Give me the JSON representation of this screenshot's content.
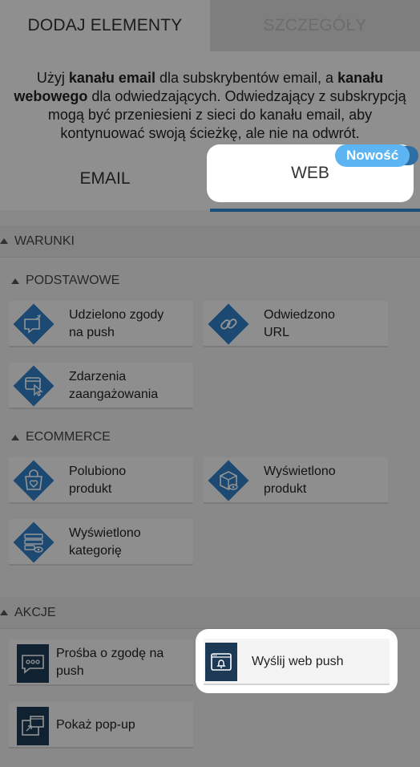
{
  "tabs": {
    "add_elements": "DODAJ ELEMENTY",
    "details": "SZCZEGÓŁY"
  },
  "description": {
    "part1": "Użyj ",
    "bold1": "kanału email",
    "part2": " dla subskrybentów email, a ",
    "bold2": "kanału webowego",
    "part3": " dla odwiedzających. Odwiedzający z subskrypcją mogą być przeniesieni z sieci do kanału email, aby kontynuować swoją ścieżkę, ale nie na odwrót."
  },
  "channels": {
    "email": "EMAIL",
    "web": "WEB",
    "new_badge": "Nowość"
  },
  "sections": {
    "conditions": "WARUNKI",
    "basic": "PODSTAWOWE",
    "ecommerce": "ECOMMERCE",
    "actions": "AKCJE"
  },
  "basic_tiles": [
    {
      "label_line1": "Udzielono zgody",
      "label_line2": "na push",
      "icon": "push-consent-icon"
    },
    {
      "label_line1": "Odwiedzono",
      "label_line2": "URL",
      "icon": "link-icon"
    },
    {
      "label_line1": "Zdarzenia",
      "label_line2": "zaangażowania",
      "icon": "engagement-click-icon"
    }
  ],
  "ecommerce_tiles": [
    {
      "label_line1": "Polubiono",
      "label_line2": "produkt",
      "icon": "liked-bag-icon"
    },
    {
      "label_line1": "Wyświetlono",
      "label_line2": "produkt",
      "icon": "viewed-box-icon"
    },
    {
      "label_line1": "Wyświetlono",
      "label_line2": "kategorię",
      "icon": "viewed-category-icon"
    }
  ],
  "action_tiles": [
    {
      "label_line1": "Prośba o zgodę na",
      "label_line2": "push",
      "icon": "chat-dots-icon"
    },
    {
      "label": "Wyślij web push",
      "icon": "browser-bell-icon"
    },
    {
      "label": "Pokaż pop-up",
      "icon": "popup-window-icon"
    }
  ],
  "colors": {
    "accent_blue": "#2f7fc5",
    "badge_blue": "#5cb5f2",
    "action_dark": "#1c3a56"
  }
}
